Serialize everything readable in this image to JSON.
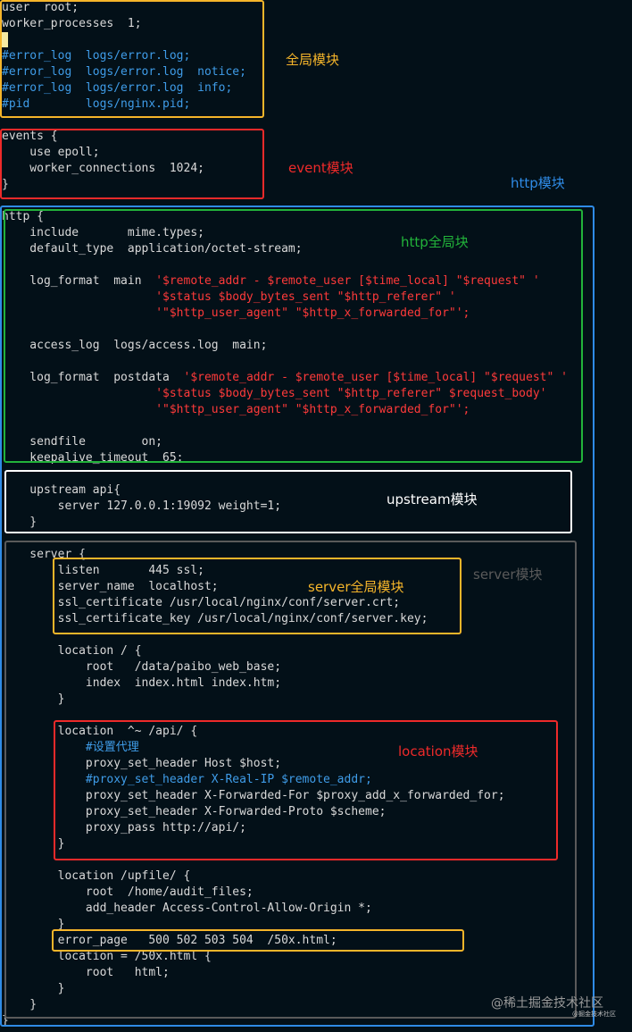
{
  "colors": {
    "background": "#031018",
    "code_text": "#d9d9d9",
    "comment": "#3f9ce8",
    "string": "#ff3a3a",
    "yellow": "#f5b52a",
    "red": "#ee2a2a",
    "blue": "#2f8be6",
    "green": "#22b33a",
    "white": "#ffffff",
    "gray": "#5a5a5a"
  },
  "code_lines": [
    [
      {
        "t": "user  root;",
        "c": "default"
      }
    ],
    [
      {
        "t": "worker_processes  1;",
        "c": "default"
      }
    ],
    [],
    [
      {
        "t": "#error_log  logs/error.log;",
        "c": "comment"
      }
    ],
    [
      {
        "t": "#error_log  logs/error.log  notice;",
        "c": "comment"
      }
    ],
    [
      {
        "t": "#error_log  logs/error.log  info;",
        "c": "comment"
      }
    ],
    [
      {
        "t": "#pid        logs/nginx.pid;",
        "c": "comment"
      }
    ],
    [],
    [
      {
        "t": "events {",
        "c": "default"
      }
    ],
    [
      {
        "t": "    use epoll;",
        "c": "default"
      }
    ],
    [
      {
        "t": "    worker_connections  1024;",
        "c": "default"
      }
    ],
    [
      {
        "t": "}",
        "c": "default"
      }
    ],
    [],
    [
      {
        "t": "http {",
        "c": "default"
      }
    ],
    [
      {
        "t": "    include       mime.types;",
        "c": "default"
      }
    ],
    [
      {
        "t": "    default_type  application/octet-stream;",
        "c": "default"
      }
    ],
    [],
    [
      {
        "t": "    log_format  main  ",
        "c": "default"
      },
      {
        "t": "'$remote_addr - $remote_user [$time_local] \"$request\" '",
        "c": "string"
      }
    ],
    [
      {
        "t": "                      ",
        "c": "default"
      },
      {
        "t": "'$status $body_bytes_sent \"$http_referer\" '",
        "c": "string"
      }
    ],
    [
      {
        "t": "                      ",
        "c": "default"
      },
      {
        "t": "'\"$http_user_agent\" \"$http_x_forwarded_for\"';",
        "c": "string"
      }
    ],
    [],
    [
      {
        "t": "    access_log  logs/access.log  main;",
        "c": "default"
      }
    ],
    [],
    [
      {
        "t": "    log_format  postdata  ",
        "c": "default"
      },
      {
        "t": "'$remote_addr - $remote_user [$time_local] \"$request\" '",
        "c": "string"
      }
    ],
    [
      {
        "t": "                      ",
        "c": "default"
      },
      {
        "t": "'$status $body_bytes_sent \"$http_referer\" $request_body'",
        "c": "string"
      }
    ],
    [
      {
        "t": "                      ",
        "c": "default"
      },
      {
        "t": "'\"$http_user_agent\" \"$http_x_forwarded_for\"';",
        "c": "string"
      }
    ],
    [],
    [
      {
        "t": "    sendfile        on;",
        "c": "default"
      }
    ],
    [
      {
        "t": "    keepalive_timeout  65;",
        "c": "default"
      }
    ],
    [],
    [
      {
        "t": "    upstream api{",
        "c": "default"
      }
    ],
    [
      {
        "t": "        server 127.0.0.1:19092 weight=1;",
        "c": "default"
      }
    ],
    [
      {
        "t": "    }",
        "c": "default"
      }
    ],
    [],
    [
      {
        "t": "    server {",
        "c": "default"
      }
    ],
    [
      {
        "t": "        listen       445 ssl;",
        "c": "default"
      }
    ],
    [
      {
        "t": "        server_name  localhost;",
        "c": "default"
      }
    ],
    [
      {
        "t": "        ssl_certificate /usr/local/nginx/conf/server.crt;",
        "c": "default"
      }
    ],
    [
      {
        "t": "        ssl_certificate_key /usr/local/nginx/conf/server.key;",
        "c": "default"
      }
    ],
    [],
    [
      {
        "t": "        location / {",
        "c": "default"
      }
    ],
    [
      {
        "t": "            root   /data/paibo_web_base;",
        "c": "default"
      }
    ],
    [
      {
        "t": "            index  index.html index.htm;",
        "c": "default"
      }
    ],
    [
      {
        "t": "        }",
        "c": "default"
      }
    ],
    [],
    [
      {
        "t": "        location  ^~ /api/ {",
        "c": "default"
      }
    ],
    [
      {
        "t": "            #设置代理",
        "c": "comment"
      }
    ],
    [
      {
        "t": "            proxy_set_header Host $host;",
        "c": "default"
      }
    ],
    [
      {
        "t": "            #proxy_set_header X-Real-IP $remote_addr;",
        "c": "comment"
      }
    ],
    [
      {
        "t": "            proxy_set_header X-Forwarded-For $proxy_add_x_forwarded_for;",
        "c": "default"
      }
    ],
    [
      {
        "t": "            proxy_set_header X-Forwarded-Proto $scheme;",
        "c": "default"
      }
    ],
    [
      {
        "t": "            proxy_pass http://api/;",
        "c": "default"
      }
    ],
    [
      {
        "t": "        }",
        "c": "default"
      }
    ],
    [],
    [
      {
        "t": "        location /upfile/ {",
        "c": "default"
      }
    ],
    [
      {
        "t": "            root  /home/audit_files;",
        "c": "default"
      }
    ],
    [
      {
        "t": "            add_header Access-Control-Allow-Origin *;",
        "c": "default"
      }
    ],
    [
      {
        "t": "        }",
        "c": "default"
      }
    ],
    [
      {
        "t": "        error_page   500 502 503 504  /50x.html;",
        "c": "default"
      }
    ],
    [
      {
        "t": "        location = /50x.html {",
        "c": "default"
      }
    ],
    [
      {
        "t": "            root   html;",
        "c": "default"
      }
    ],
    [
      {
        "t": "        }",
        "c": "default"
      }
    ],
    [
      {
        "t": "    }",
        "c": "default"
      }
    ],
    [
      {
        "t": "}",
        "c": "default"
      }
    ]
  ],
  "labels": {
    "global_module": "全局模块",
    "event_module": "event模块",
    "http_module": "http模块",
    "http_global_module": "http全局块",
    "upstream_module": "upstream模块",
    "server_module": "server模块",
    "server_global_module": "server全局模块",
    "location_module": "location模块"
  },
  "watermark": {
    "main": "@稀土掘金技术社区",
    "small": "@掘金技术社区"
  }
}
